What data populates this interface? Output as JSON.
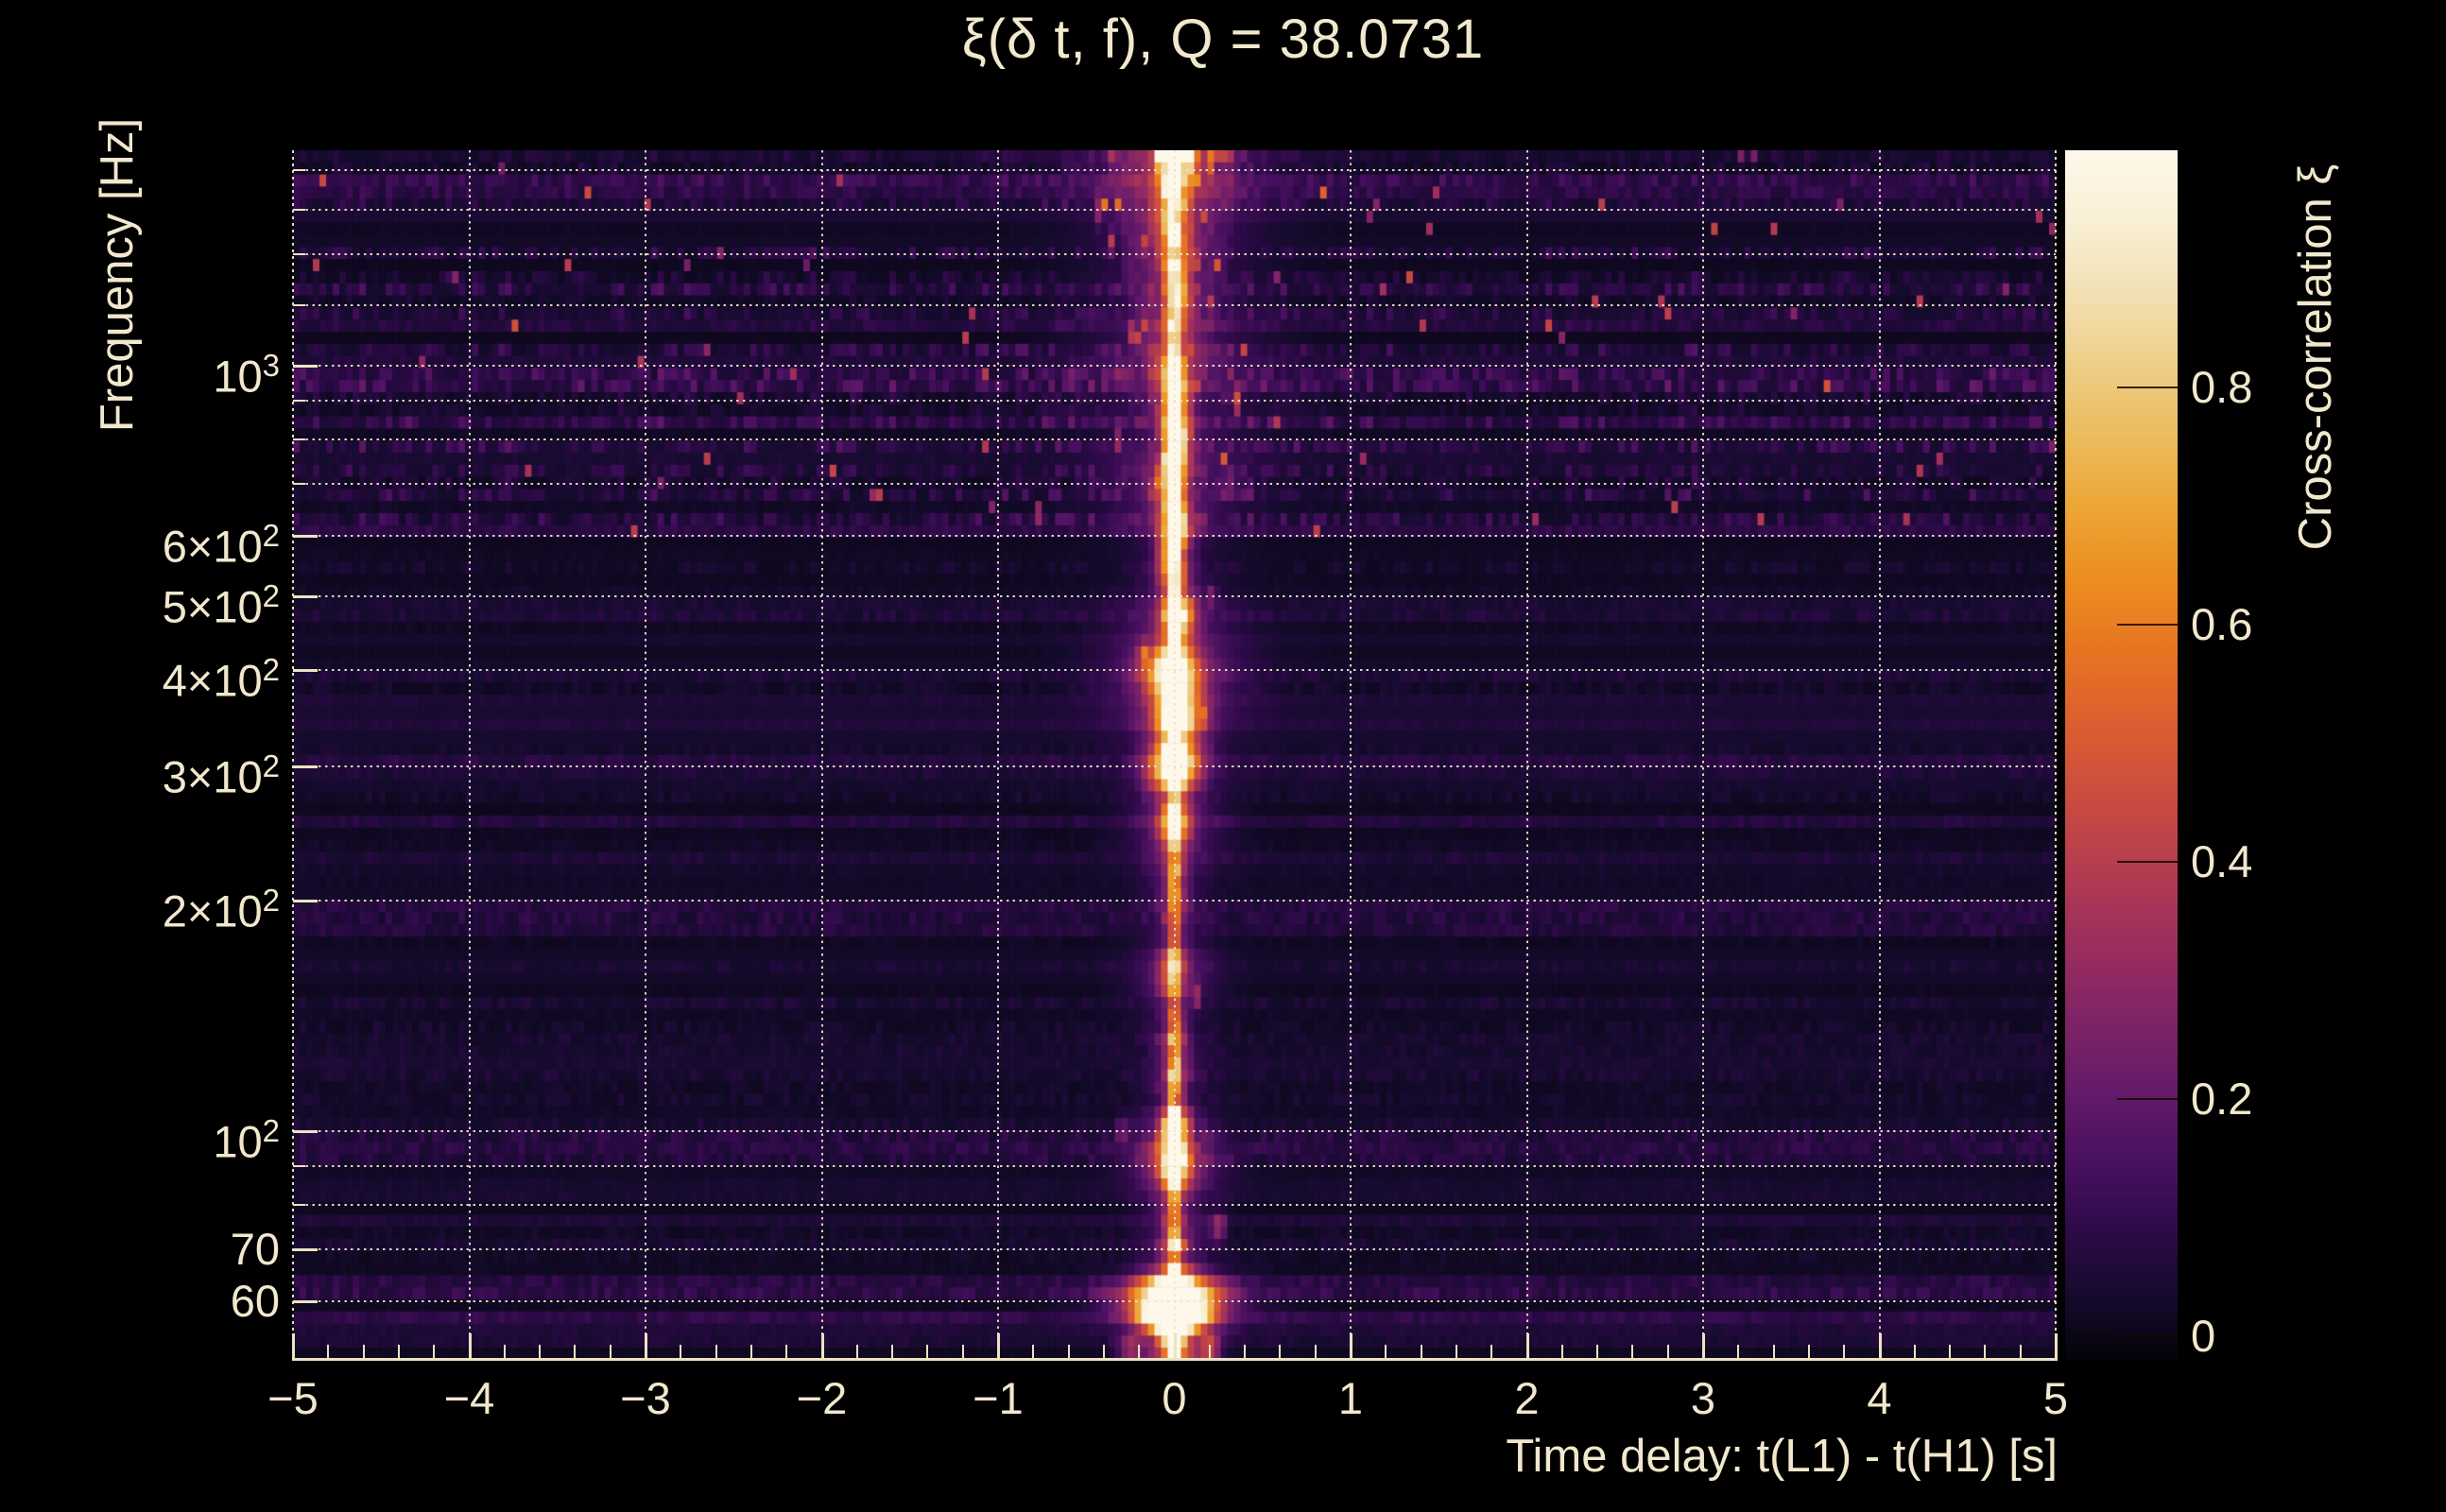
{
  "colors": {
    "background": "#000000",
    "text": "#f1e8cd",
    "grid": "#e9e0c4",
    "axis_line": "#ece2c4",
    "colorbar_tick": "#140a05"
  },
  "chart_data": {
    "type": "heatmap",
    "title": "ξ(δ t, f), Q = 38.0731",
    "q_value": 38.0731,
    "xlabel": "Time delay: t(L1) - t(H1) [s]",
    "ylabel": "Frequency [Hz]",
    "colorbar_label": "Cross-correlation ξ",
    "x_range": [
      -5,
      5
    ],
    "x_ticks": [
      -5,
      -4,
      -3,
      -2,
      -1,
      0,
      1,
      2,
      3,
      4,
      5
    ],
    "x_minor_step": 0.2,
    "y_scale": "log",
    "y_range_hz": [
      50,
      1910
    ],
    "y_tick_labels": [
      {
        "f": 1000,
        "base": "10",
        "sup": "3"
      },
      {
        "f": 600,
        "base": "6×10",
        "sup": "2"
      },
      {
        "f": 500,
        "base": "5×10",
        "sup": "2"
      },
      {
        "f": 400,
        "base": "4×10",
        "sup": "2"
      },
      {
        "f": 300,
        "base": "3×10",
        "sup": "2"
      },
      {
        "f": 200,
        "base": "2×10",
        "sup": "2"
      },
      {
        "f": 100,
        "base": "10",
        "sup": "2"
      },
      {
        "f": 70,
        "base": "70",
        "sup": ""
      },
      {
        "f": 60,
        "base": "60",
        "sup": ""
      }
    ],
    "y_gridlines_hz": [
      1800,
      1600,
      1400,
      1200,
      1000,
      900,
      800,
      700,
      600,
      500,
      400,
      300,
      200,
      100,
      90,
      80,
      70,
      60
    ],
    "colorbar": {
      "value_range": [
        -0.02,
        1.0
      ],
      "ticks": [
        0,
        0.2,
        0.4,
        0.6,
        0.8
      ],
      "tick_labels": [
        "0",
        "0.2",
        "0.4",
        "0.6",
        "0.8"
      ]
    },
    "colormap": {
      "name": "inferno-like (dark purple to cream white)",
      "stops": [
        [
          0.0,
          "#050308"
        ],
        [
          0.05,
          "#140b2c"
        ],
        [
          0.1,
          "#2b0a45"
        ],
        [
          0.16,
          "#47105f"
        ],
        [
          0.22,
          "#641a68"
        ],
        [
          0.28,
          "#7f2366"
        ],
        [
          0.34,
          "#9a2d5e"
        ],
        [
          0.4,
          "#b23b52"
        ],
        [
          0.46,
          "#c84a41"
        ],
        [
          0.52,
          "#d95d31"
        ],
        [
          0.58,
          "#e67223"
        ],
        [
          0.64,
          "#ec8b20"
        ],
        [
          0.7,
          "#eda433"
        ],
        [
          0.76,
          "#ecba5b"
        ],
        [
          0.82,
          "#eecd85"
        ],
        [
          0.88,
          "#f2e0b2"
        ],
        [
          0.94,
          "#f9efd5"
        ],
        [
          1.0,
          "#fdf8ea"
        ]
      ]
    },
    "features": {
      "description": "Cross-correlation spectrogram: bright near-white vertical ridge at time delay 0 s spanning 50–1900 Hz, strongest near 60 Hz, 100 Hz, 300–500 Hz; purple haze fan widening above 700 Hz up to ±0.4 s; faint purple noise rows elsewhere.",
      "stripe": {
        "dt0": 0,
        "sigma_core_s": 0.012,
        "sigma_halo_s": 0.05,
        "sigma_wide_s": 0.13
      },
      "stripe_profile": [
        [
          50,
          57,
          0.9,
          0.5,
          0.3
        ],
        [
          57,
          64,
          1.0,
          0.6,
          0.4
        ],
        [
          64,
          78,
          0.8,
          0.35,
          0.15
        ],
        [
          78,
          88,
          0.8,
          0.3,
          0.1
        ],
        [
          88,
          108,
          0.95,
          0.45,
          0.15
        ],
        [
          108,
          135,
          0.8,
          0.3,
          0.08
        ],
        [
          135,
          185,
          0.7,
          0.2,
          0.05
        ],
        [
          185,
          245,
          0.8,
          0.3,
          0.08
        ],
        [
          245,
          285,
          0.9,
          0.4,
          0.1
        ],
        [
          285,
          335,
          0.97,
          0.5,
          0.15
        ],
        [
          335,
          430,
          0.92,
          0.5,
          0.18
        ],
        [
          430,
          540,
          0.85,
          0.45,
          0.12
        ],
        [
          540,
          660,
          0.8,
          0.4,
          0.08
        ],
        [
          660,
          820,
          0.75,
          0.35,
          0.06
        ],
        [
          820,
          1060,
          0.8,
          0.35,
          0.05
        ],
        [
          1060,
          1350,
          0.7,
          0.25,
          0.04
        ],
        [
          1350,
          1910,
          0.75,
          0.3,
          0.05
        ]
      ],
      "blobs": [
        [
          60,
          0,
          0.16,
          0.022,
          0.95
        ],
        [
          57,
          0,
          0.1,
          0.012,
          0.9
        ],
        [
          90,
          0,
          0.06,
          0.02,
          0.5
        ],
        [
          100,
          0,
          0.05,
          0.015,
          0.45
        ],
        [
          160,
          -0.02,
          0.05,
          0.02,
          0.3
        ],
        [
          250,
          0,
          0.06,
          0.015,
          0.5
        ],
        [
          300,
          0,
          0.1,
          0.02,
          0.7
        ],
        [
          350,
          0.02,
          0.09,
          0.025,
          0.65
        ],
        [
          400,
          -0.02,
          0.1,
          0.02,
          0.6
        ],
        [
          470,
          0.03,
          0.06,
          0.02,
          0.5
        ],
        [
          560,
          -0.02,
          0.05,
          0.02,
          0.45
        ],
        [
          620,
          0.01,
          0.05,
          0.02,
          0.5
        ],
        [
          700,
          -0.03,
          0.06,
          0.02,
          0.45
        ],
        [
          800,
          0.02,
          0.05,
          0.02,
          0.5
        ],
        [
          950,
          0,
          0.04,
          0.02,
          0.55
        ],
        [
          1250,
          0.02,
          0.05,
          0.03,
          0.35
        ],
        [
          1600,
          -0.02,
          0.06,
          0.03,
          0.3
        ],
        [
          1850,
          0.01,
          0.07,
          0.025,
          0.35
        ],
        [
          1900,
          0.3,
          0.015,
          0.01,
          0.5
        ],
        [
          1880,
          0.1,
          0.02,
          0.012,
          0.5
        ],
        [
          1880,
          -0.08,
          0.02,
          0.012,
          0.45
        ],
        [
          1850,
          0.2,
          0.015,
          0.01,
          0.4
        ],
        [
          1600,
          -0.42,
          0.01,
          0.015,
          0.45
        ],
        [
          1450,
          -0.35,
          0.01,
          0.01,
          0.4
        ],
        [
          900,
          0.35,
          0.012,
          0.012,
          0.45
        ],
        [
          800,
          -0.33,
          0.01,
          0.01,
          0.4
        ],
        [
          700,
          0.3,
          0.01,
          0.012,
          0.35
        ],
        [
          1100,
          -0.25,
          0.01,
          0.01,
          0.35
        ],
        [
          500,
          0.22,
          0.012,
          0.01,
          0.3
        ],
        [
          420,
          -0.18,
          0.015,
          0.01,
          0.35
        ],
        [
          350,
          0.18,
          0.012,
          0.01,
          0.3
        ],
        [
          280,
          -0.15,
          0.01,
          0.01,
          0.3
        ],
        [
          150,
          0.12,
          0.015,
          0.01,
          0.3
        ],
        [
          100,
          -0.3,
          0.02,
          0.01,
          0.25
        ],
        [
          75,
          0.25,
          0.03,
          0.012,
          0.3
        ],
        [
          52,
          0.2,
          0.04,
          0.01,
          0.4
        ],
        [
          52,
          -0.25,
          0.05,
          0.01,
          0.3
        ],
        [
          400,
          0,
          0.28,
          0.06,
          0.18
        ],
        [
          250,
          0,
          0.2,
          0.04,
          0.12
        ],
        [
          160,
          0,
          0.18,
          0.03,
          0.12
        ],
        [
          90,
          0,
          0.2,
          0.03,
          0.15
        ],
        [
          60,
          0,
          0.3,
          0.02,
          0.2
        ],
        [
          700,
          0,
          0.3,
          0.05,
          0.12
        ],
        [
          1000,
          0,
          0.35,
          0.06,
          0.12
        ],
        [
          1500,
          0,
          0.3,
          0.08,
          0.1
        ],
        [
          1900,
          0,
          0.4,
          0.06,
          0.12
        ]
      ],
      "noise_bands_hz": [
        [
          1700,
          0.05
        ],
        [
          950,
          0.06
        ],
        [
          620,
          0.04
        ],
        [
          480,
          0.03
        ],
        [
          300,
          0.03
        ],
        [
          190,
          0.05
        ],
        [
          95,
          0.05
        ],
        [
          63,
          0.06
        ],
        [
          55,
          0.04
        ]
      ],
      "fan": {
        "f_start_hz": 700,
        "width0_s": 0.05,
        "growth_s_per_decade": 0.82,
        "amp": 0.16
      },
      "noise": {
        "floor": 0.012,
        "low_amp": 0.045,
        "high_amp": 0.12,
        "high_f_hz": 600
      }
    }
  }
}
